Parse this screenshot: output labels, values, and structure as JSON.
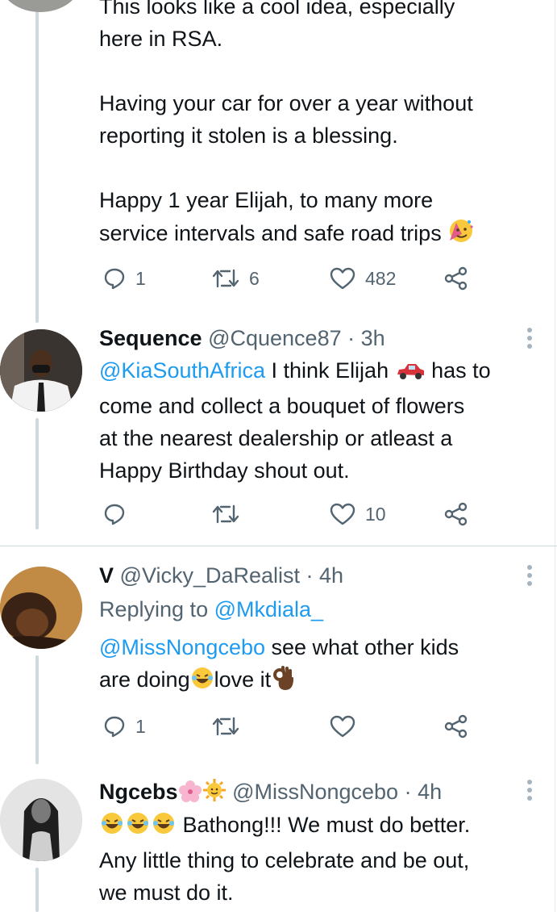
{
  "tweets": [
    {
      "body": [
        "This looks like a cool idea, especially",
        "here in RSA.",
        "",
        "Having your car for over a year without",
        "reporting it stolen is a blessing.",
        "",
        "Happy 1 year Elijah, to many more",
        "service intervals and safe road trips"
      ],
      "body_emoji": "partying-face",
      "actions": {
        "reply": "1",
        "retweet": "6",
        "like": "482"
      }
    },
    {
      "name": "Sequence",
      "handle": "@Cquence87",
      "time": "· 3h",
      "mention": "@KiaSouthAfrica",
      "line1_rest": " I think Elijah ",
      "car_emoji": "red-car",
      "line1_tail": " has to",
      "body": [
        "come and collect a bouquet of flowers",
        "at the nearest dealership or atleast a",
        "Happy Birthday shout out."
      ],
      "actions": {
        "reply": "",
        "retweet": "",
        "like": "10"
      }
    },
    {
      "name": "V",
      "handle": "@Vicky_DaRealist",
      "time": "· 4h",
      "replying_label": "Replying to ",
      "replying_to": "@Mkdiala_",
      "mention": "@MissNongcebo",
      "line1_rest": " see what other kids",
      "line2_a": "are doing",
      "line2_b": "love it",
      "actions": {
        "reply": "1",
        "retweet": "",
        "like": ""
      }
    },
    {
      "name": "Ngcebs",
      "name_emoji": [
        "cherry-blossom",
        "sun-with-face"
      ],
      "handle": "@MissNongcebo",
      "time": "· 4h",
      "line1_tail": " Bathong!!! We must do better.",
      "body": [
        "Any little thing to celebrate and be out,",
        "we must do it."
      ]
    }
  ],
  "colors": {
    "link": "#1d9bf0",
    "text": "#0f1419",
    "muted": "#536471",
    "line": "#cfd9de"
  }
}
